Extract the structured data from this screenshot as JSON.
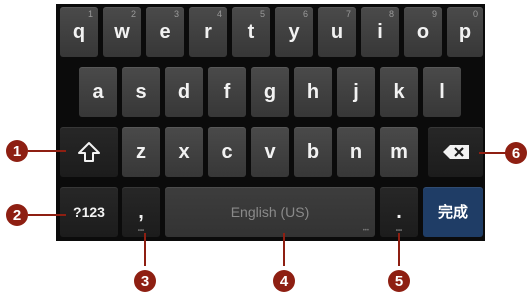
{
  "keyboard": {
    "row1": [
      {
        "label": "q",
        "hint": "1"
      },
      {
        "label": "w",
        "hint": "2"
      },
      {
        "label": "e",
        "hint": "3"
      },
      {
        "label": "r",
        "hint": "4"
      },
      {
        "label": "t",
        "hint": "5"
      },
      {
        "label": "y",
        "hint": "6"
      },
      {
        "label": "u",
        "hint": "7"
      },
      {
        "label": "i",
        "hint": "8"
      },
      {
        "label": "o",
        "hint": "9"
      },
      {
        "label": "p",
        "hint": "0"
      }
    ],
    "row2": [
      "a",
      "s",
      "d",
      "f",
      "g",
      "h",
      "j",
      "k",
      "l"
    ],
    "row3": [
      "z",
      "x",
      "c",
      "v",
      "b",
      "n",
      "m"
    ],
    "symbols_label": "?123",
    "comma_label": ",",
    "space_label": "English (US)",
    "period_label": ".",
    "enter_label": "完成",
    "key_dots": "•••"
  },
  "callouts": [
    "1",
    "2",
    "3",
    "4",
    "5",
    "6"
  ],
  "icons": {
    "shift": "shift-icon",
    "backspace": "backspace-icon"
  },
  "colors": {
    "keyboard_bg": "#0b0b0b",
    "key": "#404040",
    "enter": "#1f3d66",
    "callout": "#8e1f12"
  }
}
